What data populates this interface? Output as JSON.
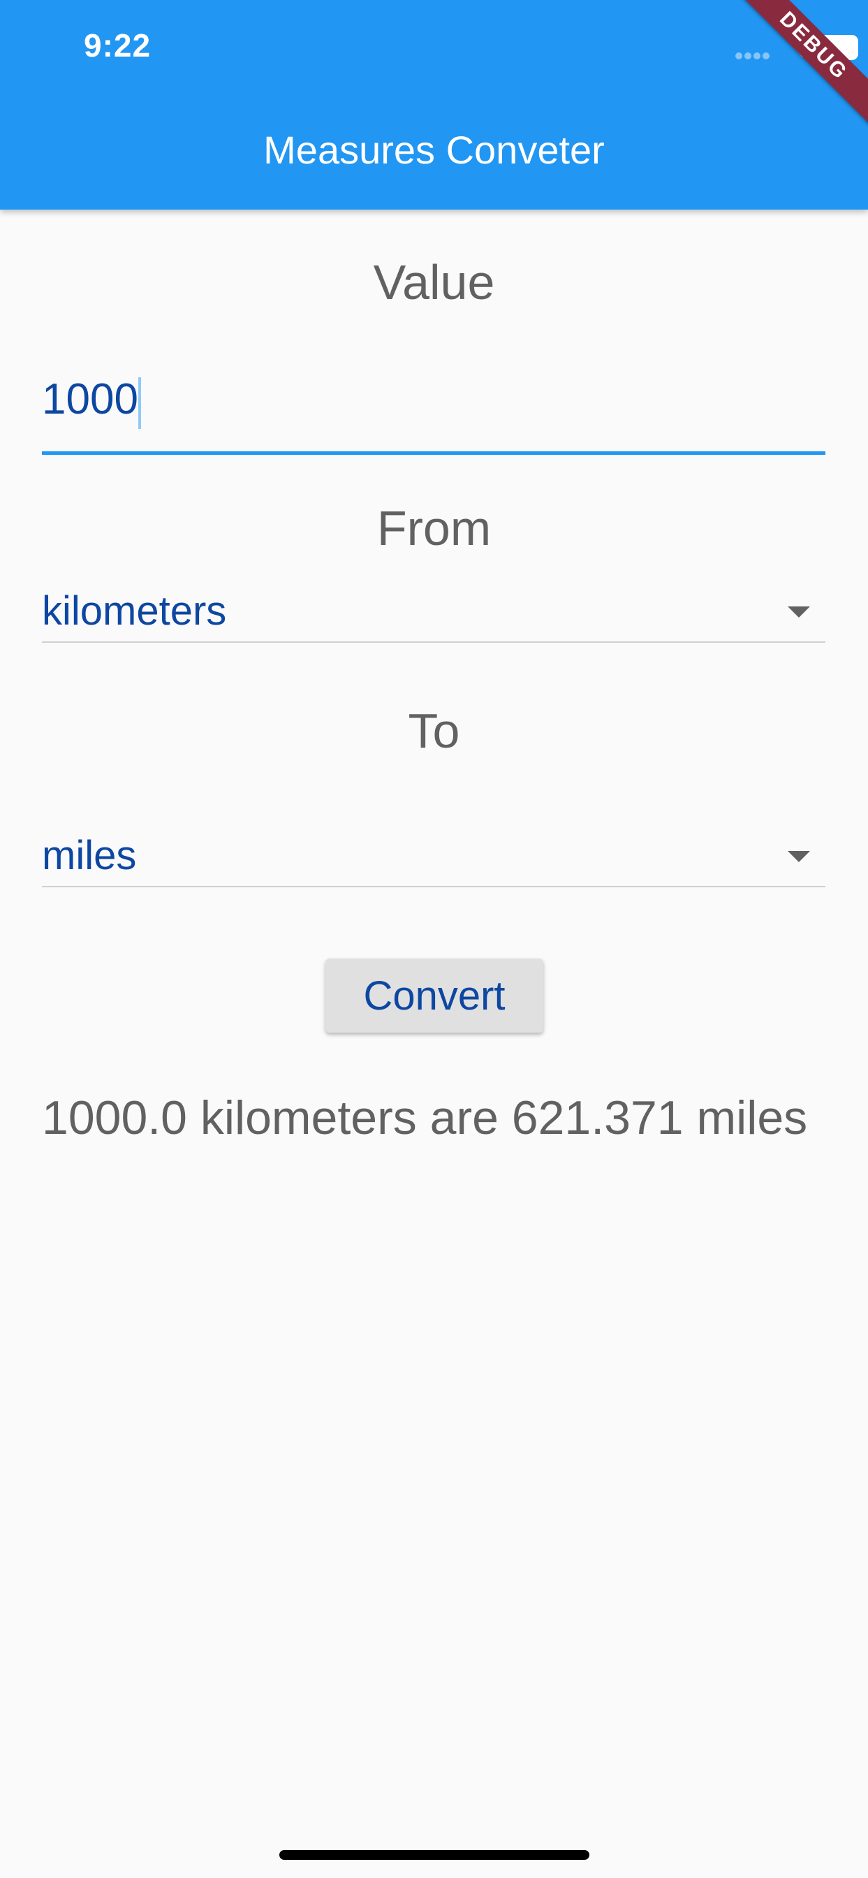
{
  "status_bar": {
    "time": "9:22",
    "wifi_icon": "wifi-icon",
    "battery_icon": "battery-icon"
  },
  "debug_banner": "DEBUG",
  "app_bar": {
    "title": "Measures Conveter"
  },
  "value_section": {
    "label": "Value",
    "input_value": "1000"
  },
  "from_section": {
    "label": "From",
    "selected": "kilometers"
  },
  "to_section": {
    "label": "To",
    "selected": "miles"
  },
  "convert_button": {
    "label": "Convert"
  },
  "result": {
    "text": "1000.0 kilometers are 621.371 miles"
  },
  "colors": {
    "primary": "#2196f3",
    "accent_text": "#0d47a1",
    "label_text": "#616161",
    "debug_ribbon": "#8a2a3e"
  }
}
